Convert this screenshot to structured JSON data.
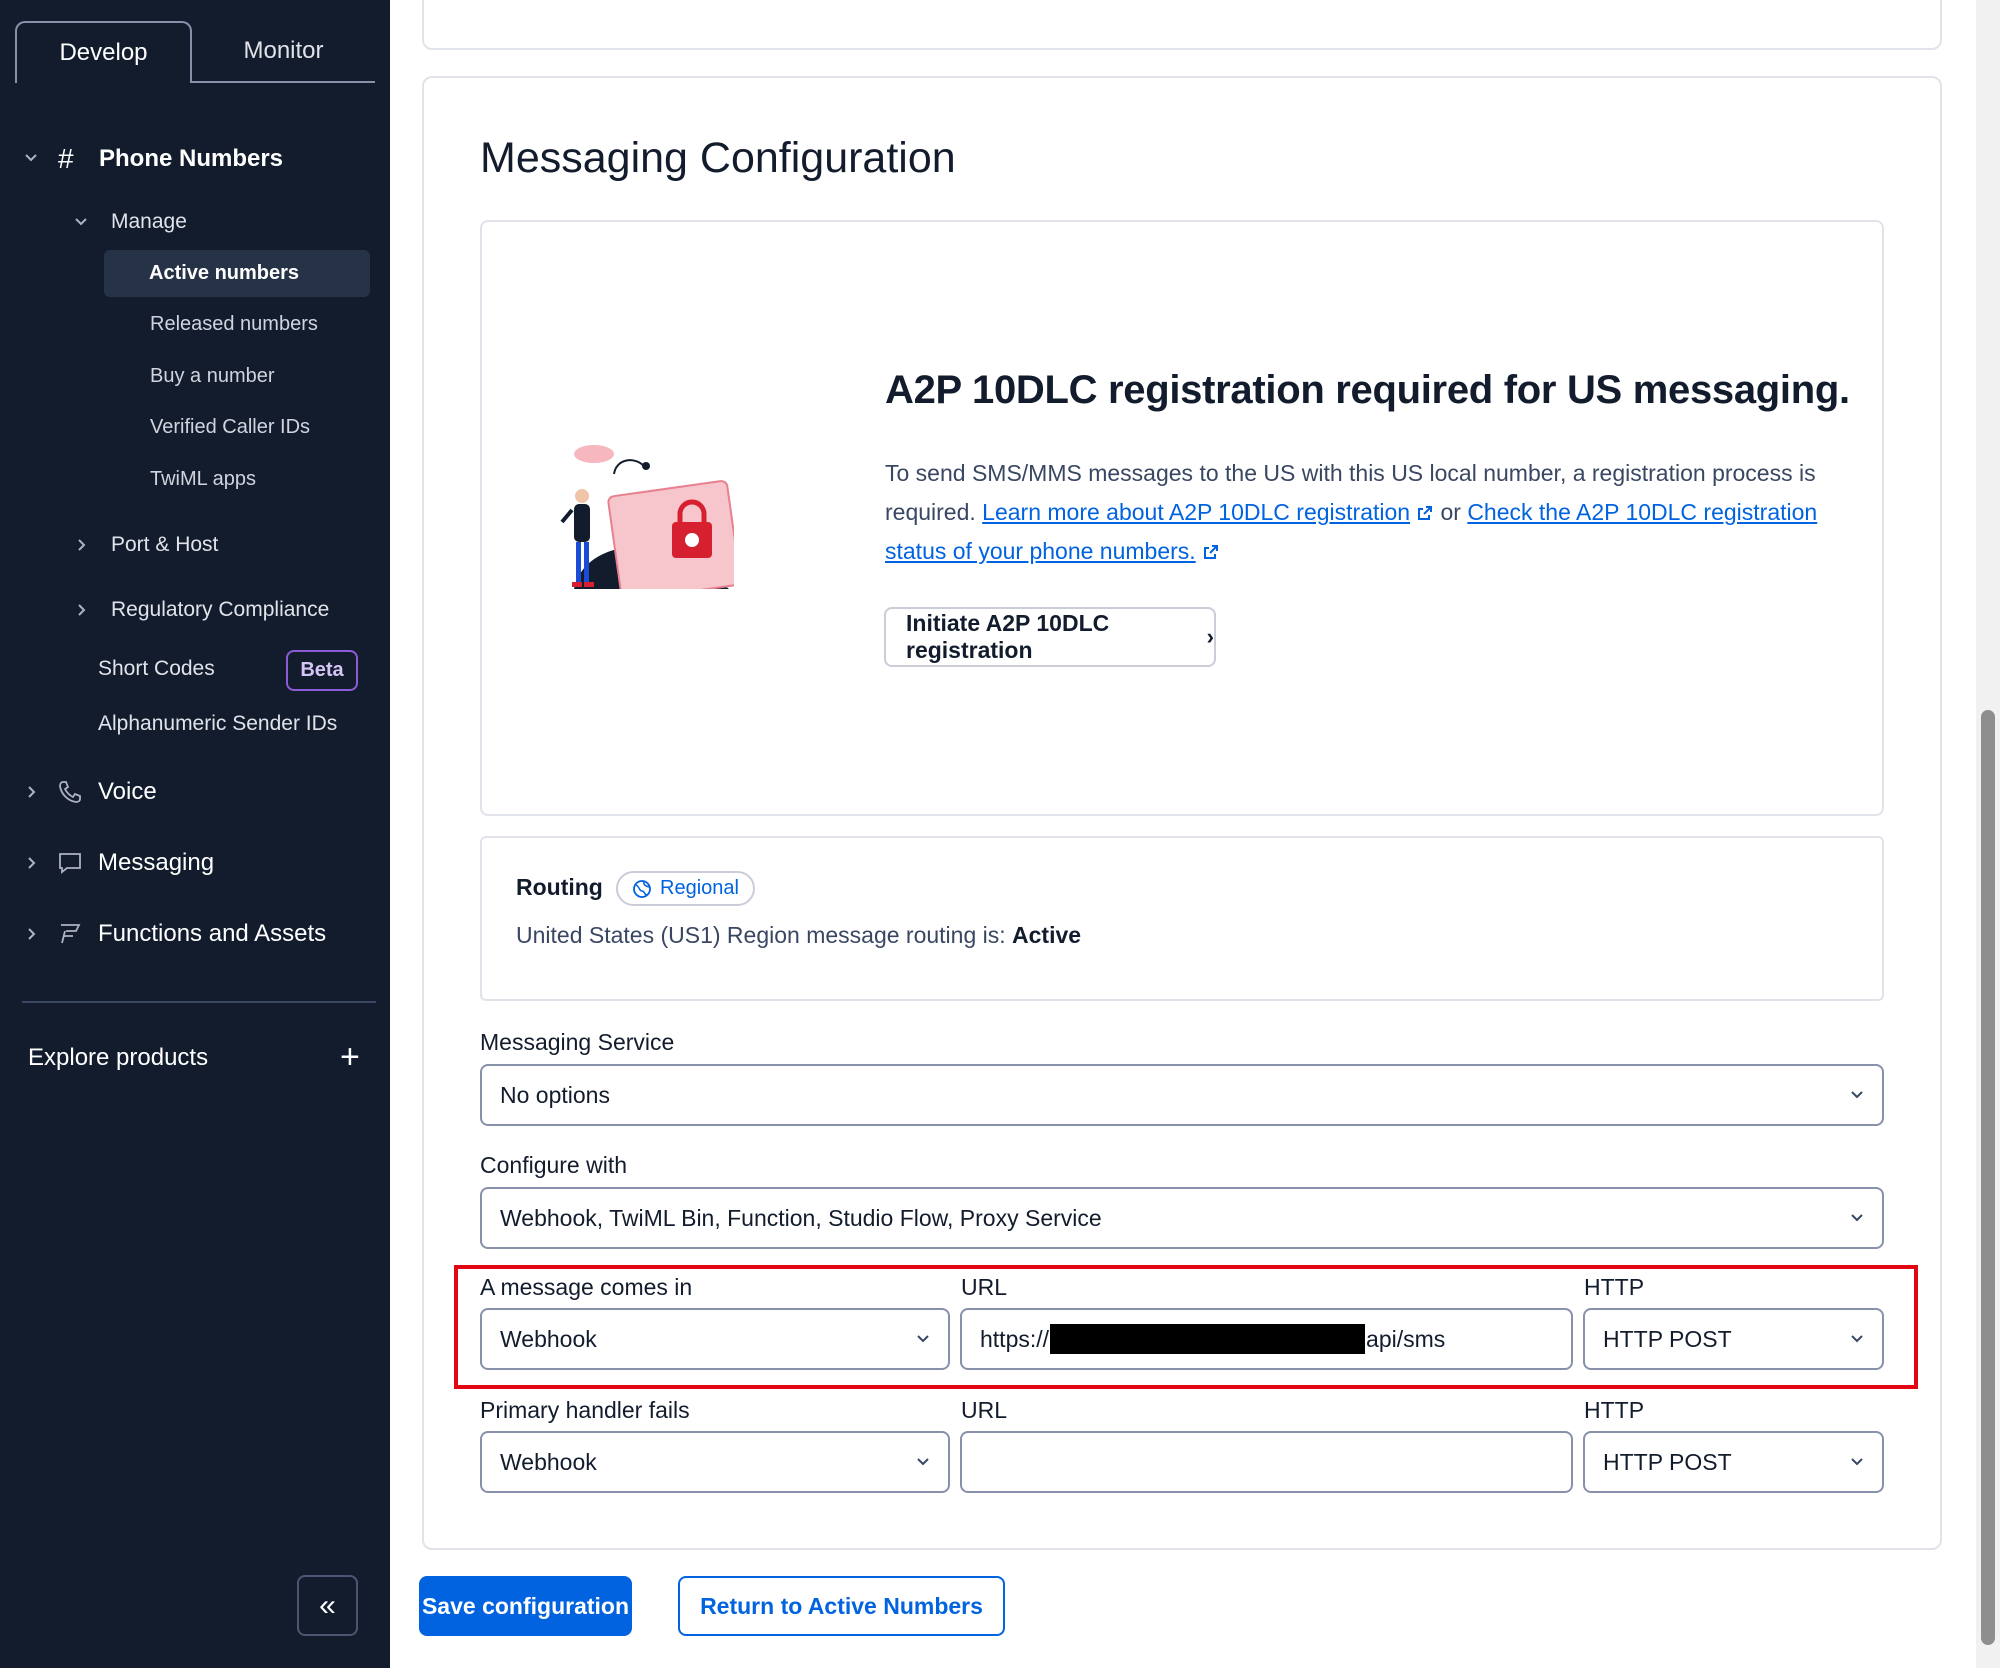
{
  "sidebar": {
    "tabs": [
      {
        "label": "Develop"
      },
      {
        "label": "Monitor"
      }
    ],
    "phone_numbers": "Phone Numbers",
    "manage": "Manage",
    "manage_items": [
      "Active numbers",
      "Released numbers",
      "Buy a number",
      "Verified Caller IDs",
      "TwiML apps"
    ],
    "port_host": "Port & Host",
    "regulatory": "Regulatory Compliance",
    "short_codes": "Short Codes",
    "beta": "Beta",
    "alphanumeric": "Alphanumeric Sender IDs",
    "voice": "Voice",
    "messaging": "Messaging",
    "functions": "Functions and Assets",
    "explore": "Explore products",
    "plus_icon": "+",
    "collapse_icon": "«"
  },
  "main": {
    "title": "Messaging Configuration",
    "a2p": {
      "title": "A2P 10DLC registration required for US messaging.",
      "text_before": "To send SMS/MMS messages to the US with this US local number, a registration process is required. ",
      "link1": "Learn more about A2P 10DLC registration",
      "or": " or ",
      "link2": "Check the A2P 10DLC registration status of your phone numbers.",
      "button": "Initiate A2P 10DLC registration",
      "button_arrow": "›"
    },
    "routing": {
      "label": "Routing",
      "pill": "Regional",
      "text": "United States (US1) Region message routing is: ",
      "status": "Active"
    },
    "messaging_service": {
      "label": "Messaging Service",
      "value": "No options"
    },
    "configure_with": {
      "label": "Configure with",
      "value": "Webhook, TwiML Bin, Function, Studio Flow, Proxy Service"
    },
    "message_comes_in": {
      "label": "A message comes in",
      "value": "Webhook",
      "url_label": "URL",
      "url_prefix": "https://",
      "url_suffix": "api/sms",
      "http_label": "HTTP",
      "http_value": "HTTP POST"
    },
    "primary_handler_fails": {
      "label": "Primary handler fails",
      "value": "Webhook",
      "url_label": "URL",
      "url_value": "",
      "http_label": "HTTP",
      "http_value": "HTTP POST"
    },
    "save_button": "Save configuration",
    "return_button": "Return to Active Numbers"
  },
  "colors": {
    "sidebar_bg": "#121c2d",
    "primary": "#0263e0",
    "highlight": "#e30613",
    "beta": "#8c5bd8"
  }
}
